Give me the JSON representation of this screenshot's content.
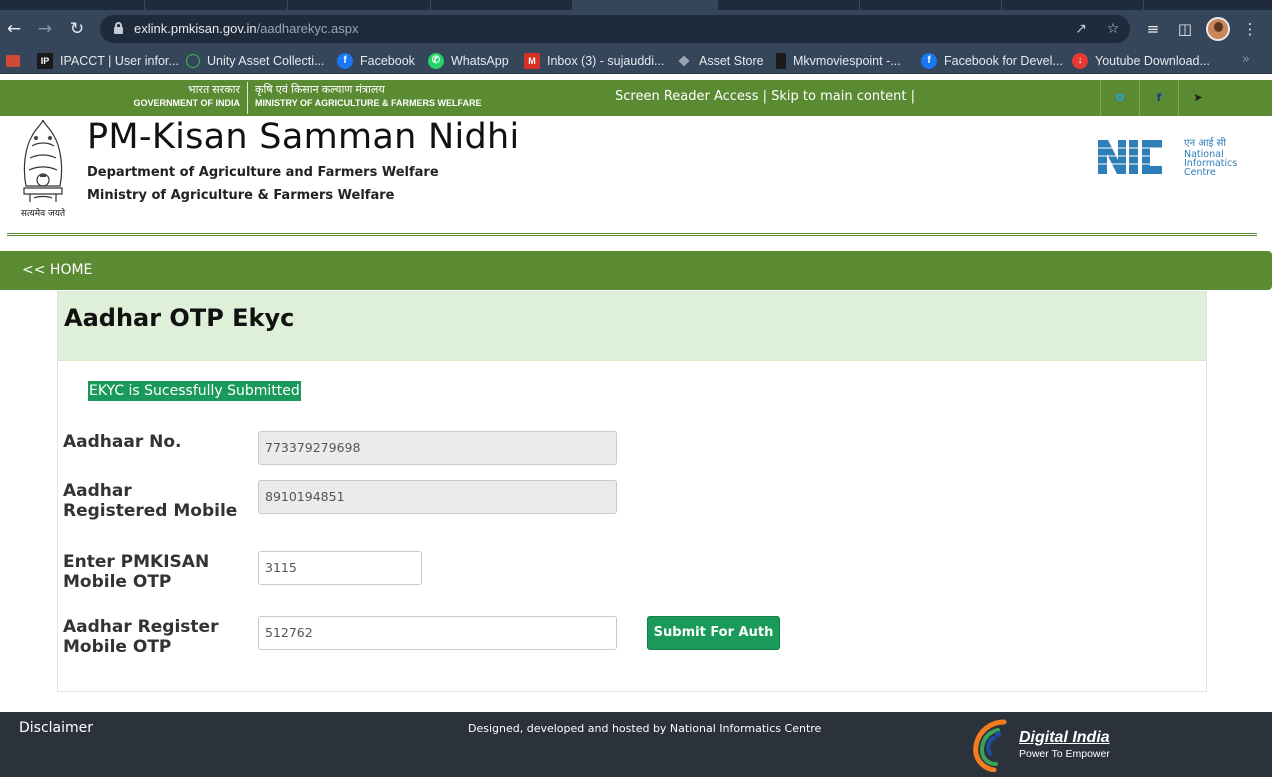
{
  "browser": {
    "url_host": "exlink.pmkisan.gov.in",
    "url_path": "/aadharekyc.aspx",
    "bookmarks": [
      {
        "label": "IPACCT | User infor...",
        "icon": "ipacct-icon",
        "color": "#1a1a1a"
      },
      {
        "label": "Unity Asset Collecti...",
        "icon": "unity-icon",
        "color": "#3fb950"
      },
      {
        "label": "Facebook",
        "icon": "facebook-icon",
        "color": "#1877f2"
      },
      {
        "label": "WhatsApp",
        "icon": "whatsapp-icon",
        "color": "#25d366"
      },
      {
        "label": "Inbox (3) - sujauddi...",
        "icon": "gmail-icon",
        "color": "#d93025"
      },
      {
        "label": "Asset Store",
        "icon": "unity-asset-store-icon",
        "color": "#9aa6b5"
      },
      {
        "label": "Mkvmoviespoint -...",
        "icon": "mkv-icon",
        "color": "#1a1a1a"
      },
      {
        "label": "Facebook for Devel...",
        "icon": "facebook-icon",
        "color": "#1877f2"
      },
      {
        "label": "Youtube Download...",
        "icon": "download-icon",
        "color": "#e53935"
      }
    ]
  },
  "govbar": {
    "gov_hindi": "भारत सरकार",
    "gov_english": "GOVERNMENT OF INDIA",
    "ministry_hindi": "कृषि एवं किसान कल्याण मंत्रालय",
    "ministry_english": "MINISTRY OF AGRICULTURE & FARMERS WELFARE",
    "screen_reader": "Screen Reader Access",
    "sep": "|",
    "skip": "Skip to main content",
    "sep2": "|"
  },
  "header": {
    "title": "PM-Kisan Samman Nidhi",
    "dept": "Department of Agriculture and Farmers Welfare",
    "ministry": "Ministry of Agriculture & Farmers Welfare",
    "emblem_caption": "सत्यमेव जयते",
    "nic_hindi": "एन आई सी",
    "nic_line1": "National",
    "nic_line2": "Informatics",
    "nic_line3": "Centre"
  },
  "nav": {
    "home": "<< HOME"
  },
  "form": {
    "title": "Aadhar OTP Ekyc",
    "success": "EKYC is Sucessfully Submitted",
    "aadhaar_label": "Aadhaar No.",
    "aadhaar_value": "773379279698",
    "mobile_label_1": "Aadhar",
    "mobile_label_2": "Registered Mobile",
    "mobile_value": "8910194851",
    "pm_otp_label_1": "Enter PMKISAN",
    "pm_otp_label_2": "Mobile OTP",
    "pm_otp_value": "3115",
    "aadhar_otp_label_1": "Aadhar Register",
    "aadhar_otp_label_2": "Mobile OTP",
    "aadhar_otp_value": "512762",
    "submit": "Submit For Auth"
  },
  "footer": {
    "disclaimer": "Disclaimer",
    "credit": "Designed, developed and hosted by National Informatics Centre",
    "di_title": "Digital India",
    "di_tagline": "Power To Empower"
  },
  "colors": {
    "brand_green": "#5a8b33",
    "success_green": "#1a9a5a",
    "panel_head": "#dff0d8",
    "footer": "#2c323c"
  }
}
